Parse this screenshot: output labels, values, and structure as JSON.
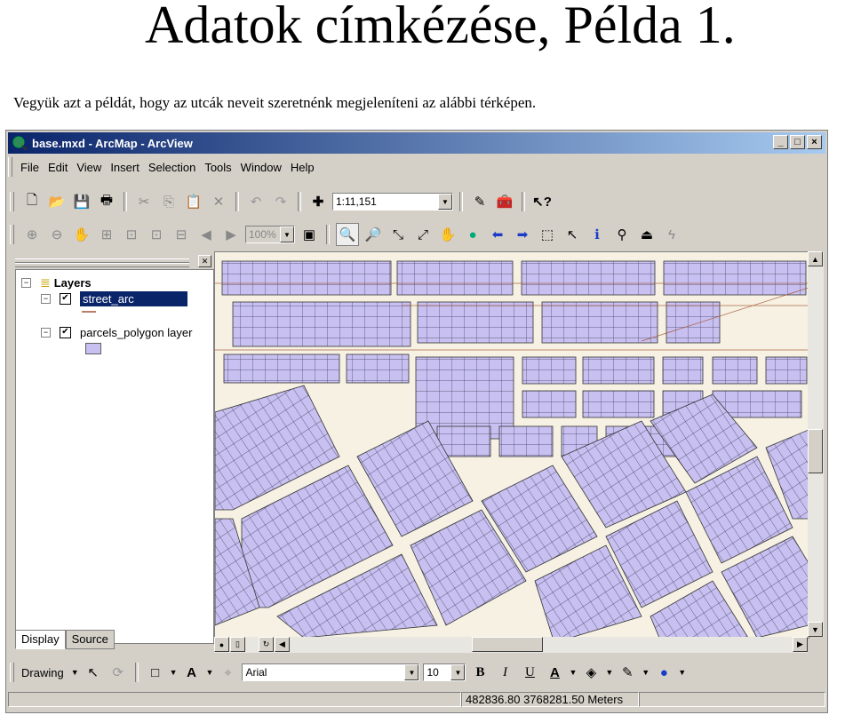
{
  "slide": {
    "title": "Adatok címkézése, Példa 1.",
    "subtitle": "Vegyük azt a példát, hogy az utcák neveit szeretnénk megjeleníteni az alábbi térképen."
  },
  "window": {
    "title": "base.mxd - ArcMap - ArcView",
    "controls": [
      "_",
      "□",
      "×"
    ]
  },
  "menu": [
    {
      "label": "File"
    },
    {
      "label": "Edit"
    },
    {
      "label": "View"
    },
    {
      "label": "Insert"
    },
    {
      "label": "Selection"
    },
    {
      "label": "Tools"
    },
    {
      "label": "Window"
    },
    {
      "label": "Help"
    }
  ],
  "toolbar": {
    "scale": "1:11,151",
    "zoom_percent": "100%"
  },
  "toc": {
    "root": "Layers",
    "layers": [
      {
        "name": "street_arc",
        "checked": true,
        "selected": true,
        "symbol_color": "#b97f6a"
      },
      {
        "name": "parcels_polygon layer",
        "checked": true,
        "selected": false,
        "symbol_color": "#c8c0f0"
      }
    ],
    "tabs": [
      "Display",
      "Source"
    ]
  },
  "drawing_toolbar": {
    "drawing_label": "Drawing",
    "font": "Arial",
    "font_size": "10",
    "bold": "B",
    "italic": "I",
    "underline": "U"
  },
  "status": {
    "coordinates": "482836.80  3768281.50 Meters"
  },
  "colors": {
    "parcel_fill": "#c8c0f0",
    "street": "#f5f0e0",
    "street_line": "#a0522d",
    "titlebar": "#0a246a"
  }
}
